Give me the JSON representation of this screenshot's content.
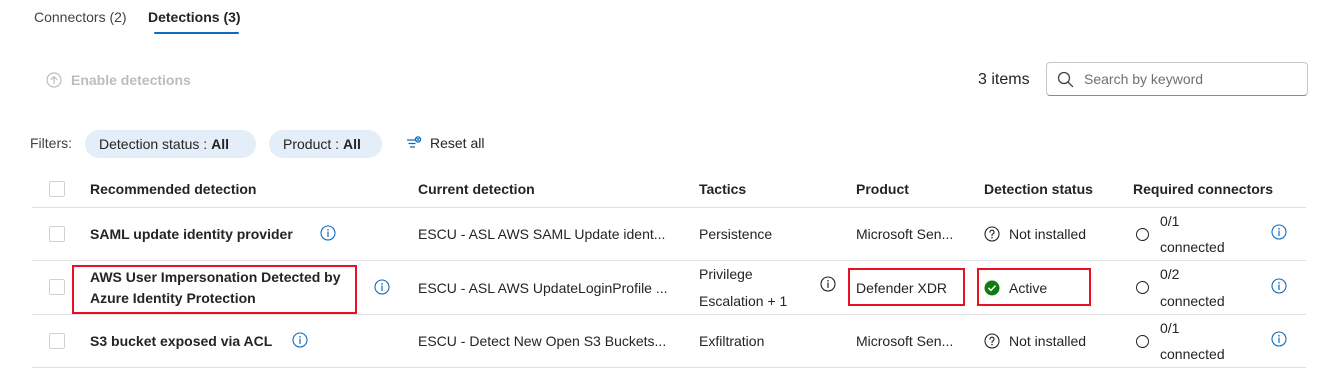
{
  "tabs": [
    {
      "label": "Connectors (2)",
      "active": false
    },
    {
      "label": "Detections (3)",
      "active": true
    }
  ],
  "toolbar": {
    "enable_label": "Enable detections",
    "items_count": "3 items",
    "search_placeholder": "Search by keyword"
  },
  "filters": {
    "label": "Filters:",
    "detection_status": {
      "key": "Detection status :",
      "value": "All"
    },
    "product": {
      "key": "Product :",
      "value": "All"
    },
    "reset_label": "Reset all"
  },
  "table": {
    "headers": {
      "recommended": "Recommended detection",
      "current": "Current detection",
      "tactics": "Tactics",
      "product": "Product",
      "status": "Detection status",
      "connectors": "Required connectors"
    },
    "rows": [
      {
        "recommended": "SAML update identity provider",
        "current": "ESCU - ASL AWS SAML Update ident...",
        "tactics_1": "Persistence",
        "tactics_2": "",
        "product": "Microsoft Sen...",
        "status": "Not installed",
        "conn_count": "0/1",
        "conn_label": "connected"
      },
      {
        "recommended_1": "AWS User Impersonation Detected by",
        "recommended_2": "Azure Identity Protection",
        "current": "ESCU - ASL AWS UpdateLoginProfile ...",
        "tactics_1": "Privilege",
        "tactics_2": "Escalation + 1",
        "product": "Defender XDR",
        "status": "Active",
        "conn_count": "0/2",
        "conn_label": "connected"
      },
      {
        "recommended": "S3 bucket exposed via ACL",
        "current": "ESCU - Detect New Open S3 Buckets...",
        "tactics_1": "Exfiltration",
        "tactics_2": "",
        "product": "Microsoft Sen...",
        "status": "Not installed",
        "conn_count": "0/1",
        "conn_label": "connected"
      }
    ]
  },
  "colors": {
    "accent": "#0f6cbd",
    "highlight": "#e81123",
    "active_status": "#107c10",
    "pill_bg": "#e3eef9"
  }
}
